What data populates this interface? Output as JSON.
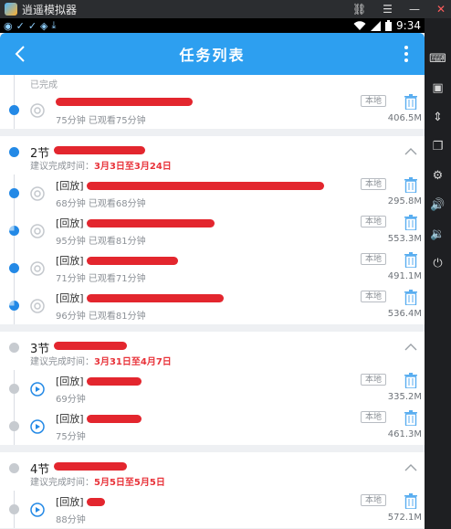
{
  "emulator": {
    "title": "逍遥模拟器",
    "side_icons": [
      "keyboard-icon",
      "video-record-icon",
      "resize-icon",
      "copy-icon",
      "settings-icon",
      "volume-up-icon",
      "volume-down-icon",
      "power-icon"
    ]
  },
  "statusbar": {
    "time": "9:34"
  },
  "appbar": {
    "title": "任务列表"
  },
  "labels": {
    "local_tag": "本地",
    "suggested_prefix": "建议完成时间："
  },
  "completed_label": "已完成",
  "first_item": {
    "meta": "75分钟 已观看75分钟",
    "size": "406.5M"
  },
  "sections": [
    {
      "title": "2节",
      "range": "3月3日至3月24日",
      "items": [
        {
          "title": "[回放]",
          "meta": "68分钟 已观看68分钟",
          "size": "295.8M",
          "progress": 1.0
        },
        {
          "title": "[回放]",
          "meta": "95分钟 已观看81分钟",
          "size": "553.3M",
          "progress": 0.85
        },
        {
          "title": "[回放]",
          "meta": "71分钟 已观看71分钟",
          "size": "491.1M",
          "progress": 1.0
        },
        {
          "title": "[回放]",
          "meta": "96分钟 已观看81分钟",
          "size": "536.4M",
          "progress": 0.84
        }
      ]
    },
    {
      "title": "3节",
      "range": "3月31日至4月7日",
      "items": [
        {
          "title": "[回放]",
          "meta": "69分钟",
          "size": "335.2M",
          "progress": 0
        },
        {
          "title": "[回放]",
          "meta": "75分钟",
          "size": "461.3M",
          "progress": 0
        }
      ]
    },
    {
      "title": "4节",
      "range": "5月5日至5月5日",
      "items": [
        {
          "title": "[回放]",
          "meta": "88分钟",
          "size": "572.1M",
          "progress": 0
        }
      ]
    }
  ],
  "colors": {
    "accent": "#2d9ff0",
    "date_red": "#e8333a",
    "redaction": "#e3262e"
  }
}
